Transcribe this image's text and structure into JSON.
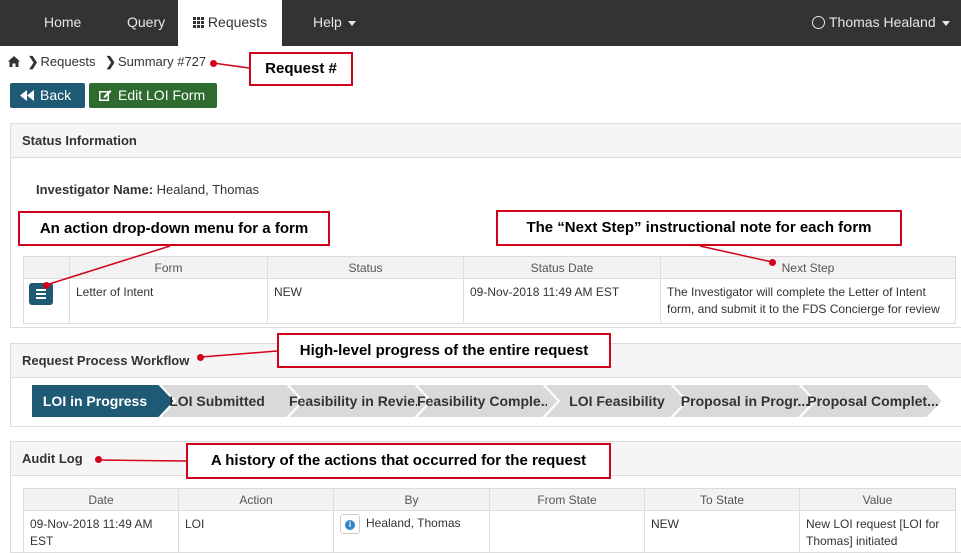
{
  "nav": {
    "home": "Home",
    "query": "Query",
    "requests": "Requests",
    "help": "Help",
    "user": "Thomas Healand"
  },
  "breadcrumb": {
    "requests": "Requests",
    "summary": "Summary #727"
  },
  "buttons": {
    "back": "Back",
    "edit": "Edit LOI Form"
  },
  "status": {
    "title": "Status Information",
    "investigator_label": "Investigator Name:",
    "investigator_value": "Healand, Thomas",
    "columns": [
      "Form",
      "Status",
      "Status Date",
      "Next Step"
    ],
    "row": {
      "form": "Letter of Intent",
      "status": "NEW",
      "date": "09-Nov-2018 11:49 AM EST",
      "next_step": "The Investigator will complete the Letter of Intent form, and submit it to the FDS Concierge for review"
    }
  },
  "workflow": {
    "title": "Request Process Workflow",
    "steps": [
      "LOI in Progress",
      "LOI Submitted",
      "Feasibility in Revie...",
      "Feasibility Comple...",
      "LOI Feasibility",
      "Proposal in Progr...",
      "Proposal Complet..."
    ],
    "active_color": "#1f5a74",
    "inactive_color": "#d9d9d9"
  },
  "audit": {
    "title": "Audit Log",
    "columns": [
      "Date",
      "Action",
      "By",
      "From State",
      "To State",
      "Value"
    ],
    "row": {
      "date": "09-Nov-2018 11:49 AM EST",
      "action": "LOI",
      "by": "Healand, Thomas",
      "from_state": "",
      "to_state": "NEW",
      "value": "New LOI request [LOI for Thomas] initiated"
    }
  },
  "callouts": {
    "request_num": "Request #",
    "action_menu": "An action drop-down menu for a form",
    "next_step": "The “Next Step” instructional note for each form",
    "progress": "High-level progress of the entire request",
    "history": "A history of the actions that occurred for the request"
  },
  "accent_color": "#d0021b"
}
